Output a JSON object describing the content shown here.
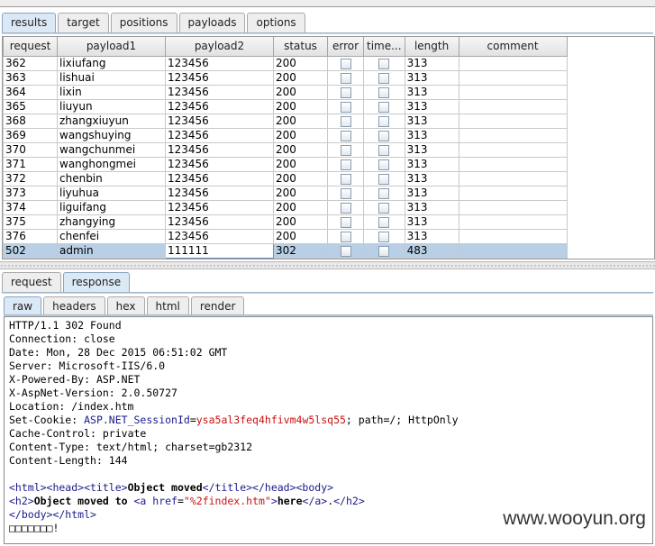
{
  "main_tabs": [
    {
      "label": "results",
      "active": true
    },
    {
      "label": "target",
      "active": false
    },
    {
      "label": "positions",
      "active": false
    },
    {
      "label": "payloads",
      "active": false
    },
    {
      "label": "options",
      "active": false
    }
  ],
  "table": {
    "columns": [
      "request",
      "payload1",
      "payload2",
      "status",
      "error",
      "time...",
      "length",
      "comment"
    ],
    "rows": [
      {
        "request": "362",
        "payload1": "lixiufang",
        "payload2": "123456",
        "status": "200",
        "error": false,
        "timeout": false,
        "length": "313",
        "comment": ""
      },
      {
        "request": "363",
        "payload1": "lishuai",
        "payload2": "123456",
        "status": "200",
        "error": false,
        "timeout": false,
        "length": "313",
        "comment": ""
      },
      {
        "request": "364",
        "payload1": "lixin",
        "payload2": "123456",
        "status": "200",
        "error": false,
        "timeout": false,
        "length": "313",
        "comment": ""
      },
      {
        "request": "365",
        "payload1": "liuyun",
        "payload2": "123456",
        "status": "200",
        "error": false,
        "timeout": false,
        "length": "313",
        "comment": ""
      },
      {
        "request": "368",
        "payload1": "zhangxiuyun",
        "payload2": "123456",
        "status": "200",
        "error": false,
        "timeout": false,
        "length": "313",
        "comment": ""
      },
      {
        "request": "369",
        "payload1": "wangshuying",
        "payload2": "123456",
        "status": "200",
        "error": false,
        "timeout": false,
        "length": "313",
        "comment": ""
      },
      {
        "request": "370",
        "payload1": "wangchunmei",
        "payload2": "123456",
        "status": "200",
        "error": false,
        "timeout": false,
        "length": "313",
        "comment": ""
      },
      {
        "request": "371",
        "payload1": "wanghongmei",
        "payload2": "123456",
        "status": "200",
        "error": false,
        "timeout": false,
        "length": "313",
        "comment": ""
      },
      {
        "request": "372",
        "payload1": "chenbin",
        "payload2": "123456",
        "status": "200",
        "error": false,
        "timeout": false,
        "length": "313",
        "comment": ""
      },
      {
        "request": "373",
        "payload1": "liyuhua",
        "payload2": "123456",
        "status": "200",
        "error": false,
        "timeout": false,
        "length": "313",
        "comment": ""
      },
      {
        "request": "374",
        "payload1": "liguifang",
        "payload2": "123456",
        "status": "200",
        "error": false,
        "timeout": false,
        "length": "313",
        "comment": ""
      },
      {
        "request": "375",
        "payload1": "zhangying",
        "payload2": "123456",
        "status": "200",
        "error": false,
        "timeout": false,
        "length": "313",
        "comment": ""
      },
      {
        "request": "376",
        "payload1": "chenfei",
        "payload2": "123456",
        "status": "200",
        "error": false,
        "timeout": false,
        "length": "313",
        "comment": ""
      },
      {
        "request": "502",
        "payload1": "admin",
        "payload2": "111111",
        "status": "302",
        "error": false,
        "timeout": false,
        "length": "483",
        "comment": "",
        "selected": true
      }
    ]
  },
  "reqresp_tabs": [
    {
      "label": "request",
      "active": false
    },
    {
      "label": "response",
      "active": true
    }
  ],
  "view_tabs": [
    {
      "label": "raw",
      "active": true
    },
    {
      "label": "headers",
      "active": false
    },
    {
      "label": "hex",
      "active": false
    },
    {
      "label": "html",
      "active": false
    },
    {
      "label": "render",
      "active": false
    }
  ],
  "response": {
    "status_line": "HTTP/1.1 302 Found",
    "headers": [
      {
        "name": "Connection",
        "value": "close"
      },
      {
        "name": "Date",
        "value": "Mon, 28 Dec 2015 06:51:02 GMT"
      },
      {
        "name": "Server",
        "value": "Microsoft-IIS/6.0"
      },
      {
        "name": "X-Powered-By",
        "value": "ASP.NET"
      },
      {
        "name": "X-AspNet-Version",
        "value": "2.0.50727"
      },
      {
        "name": "Location",
        "value": "/index.htm"
      }
    ],
    "set_cookie": {
      "name": "Set-Cookie",
      "cookie_name": "ASP.NET_SessionId",
      "cookie_value": "ysa5al3feq4hfivm4w5lsq55",
      "rest": "; path=/; HttpOnly"
    },
    "headers2": [
      {
        "name": "Cache-Control",
        "value": "private"
      },
      {
        "name": "Content-Type",
        "value": "text/html; charset=gb2312"
      },
      {
        "name": "Content-Length",
        "value": "144"
      }
    ],
    "body": {
      "title_text": "Object moved",
      "h2_text": "Object moved to ",
      "href_value": "%2findex.htm",
      "link_text": "here",
      "after_link": ".",
      "last_line": "□□□□□□□!"
    }
  },
  "watermark": "www.wooyun.org",
  "colors": {
    "active_tab": "#dbe8f5",
    "selected_row": "#b8cfe5",
    "tag_blue": "#1a1a8c",
    "value_red": "#cc1111"
  }
}
